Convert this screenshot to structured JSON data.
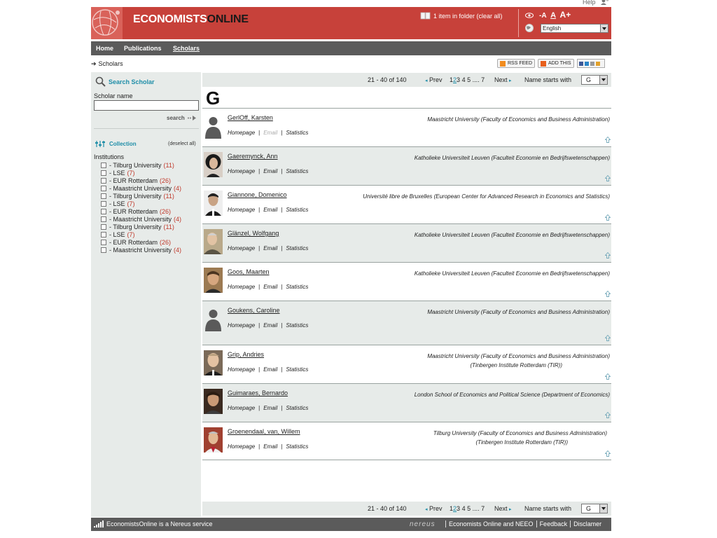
{
  "top": {
    "help": "Help"
  },
  "header": {
    "logo_economists": "ECONOMISTS",
    "logo_online": "ONLINE",
    "folder_text": "1 item in folder (clear all)",
    "font_small": "-A",
    "font_mid": "A",
    "font_large": "A+",
    "language": "English"
  },
  "nav": {
    "items": [
      "Home",
      "Publications",
      "Scholars"
    ]
  },
  "breadcrumb": {
    "current": "Scholars"
  },
  "share": {
    "rss": "RSS FEED",
    "add": "ADD THIS"
  },
  "sidebar": {
    "search_title": "Search Scholar",
    "scholar_name_label": "Scholar name",
    "scholar_name_value": "",
    "search_button": "search",
    "collection_title": "Collection",
    "deselect_all": "(deselect all)",
    "institutions_label": "Institutions",
    "institutions": [
      {
        "name": "- Tilburg University",
        "count": "(11)"
      },
      {
        "name": "- LSE",
        "count": "(7)"
      },
      {
        "name": "- EUR Rotterdam",
        "count": "(26)"
      },
      {
        "name": "- Maastricht University",
        "count": "(4)"
      },
      {
        "name": "- Tilburg University",
        "count": "(11)"
      },
      {
        "name": "- LSE",
        "count": "(7)"
      },
      {
        "name": "- EUR Rotterdam",
        "count": "(26)"
      },
      {
        "name": "- Maastricht University",
        "count": "(4)"
      },
      {
        "name": "- Tilburg University",
        "count": "(11)"
      },
      {
        "name": "- LSE",
        "count": "(7)"
      },
      {
        "name": "- EUR Rotterdam",
        "count": "(26)"
      },
      {
        "name": "- Maastricht University",
        "count": "(4)"
      }
    ]
  },
  "pager": {
    "range": "21 - 40 of 140",
    "prev": "Prev",
    "pages": [
      "1",
      "2",
      "3",
      "4",
      "5",
      "....",
      "7"
    ],
    "current_page": "2",
    "next": "Next",
    "name_starts_with": "Name starts with",
    "letter": "G"
  },
  "results": {
    "letter": "G",
    "link_homepage": "Homepage",
    "link_email": "Email",
    "link_statistics": "Statistics",
    "scholars": [
      {
        "name": "GerlOff, Karsten",
        "affiliation": "Maastricht University   (Faculty of Economics and Business Administration)",
        "affiliation2": "",
        "email_disabled": true,
        "photo": "silhouette"
      },
      {
        "name": "Gaeremynck, Ann",
        "affiliation": "Katholieke Universiteit Leuven   (Faculteit Economie en Bedrijfswetenschappen)",
        "affiliation2": "",
        "email_disabled": false,
        "photo": "portrait"
      },
      {
        "name": "Giannone, Domenico",
        "affiliation": "Université libre de Bruxelles   (European Center for Advanced Research in Economics and Statistics)",
        "affiliation2": "",
        "email_disabled": false,
        "photo": "portrait"
      },
      {
        "name": "Glänzel, Wolfgang",
        "affiliation": "Katholieke Universiteit Leuven   (Faculteit Economie en Bedrijfswetenschappen)",
        "affiliation2": "",
        "email_disabled": false,
        "photo": "portrait"
      },
      {
        "name": "Goos, Maarten",
        "affiliation": "Katholieke Universiteit Leuven   (Faculteit Economie en Bedrijfswetenschappen)",
        "affiliation2": "",
        "email_disabled": false,
        "photo": "portrait"
      },
      {
        "name": "Goukens, Caroline",
        "affiliation": "Maastricht University  (Faculty of Economics and Business Administration)",
        "affiliation2": "",
        "email_disabled": false,
        "photo": "silhouette"
      },
      {
        "name": "Grip, Andries",
        "affiliation": "Maastricht University   (Faculty of Economics and Business Administration)",
        "affiliation2": "(Tinbergen Institute Rotterdam (TIR))",
        "email_disabled": false,
        "photo": "portrait"
      },
      {
        "name": "Guimaraes, Bernardo",
        "affiliation": "London School of Economics and Political Science   (Department of Economics)",
        "affiliation2": "",
        "email_disabled": false,
        "photo": "portrait"
      },
      {
        "name": "Groenendaal, van, Willem",
        "affiliation": "Tilburg University   (Faculty of Economics and Business Administration)",
        "affiliation2": "(Tinbergen Institute Rotterdam (TIR))",
        "email_disabled": false,
        "photo": "portrait"
      }
    ]
  },
  "footer": {
    "service": "EconomistsOnline is a Nereus service",
    "nereus": "nereus",
    "links": [
      "Economists Online and NEEO",
      "Feedback",
      "Disclamer"
    ]
  }
}
